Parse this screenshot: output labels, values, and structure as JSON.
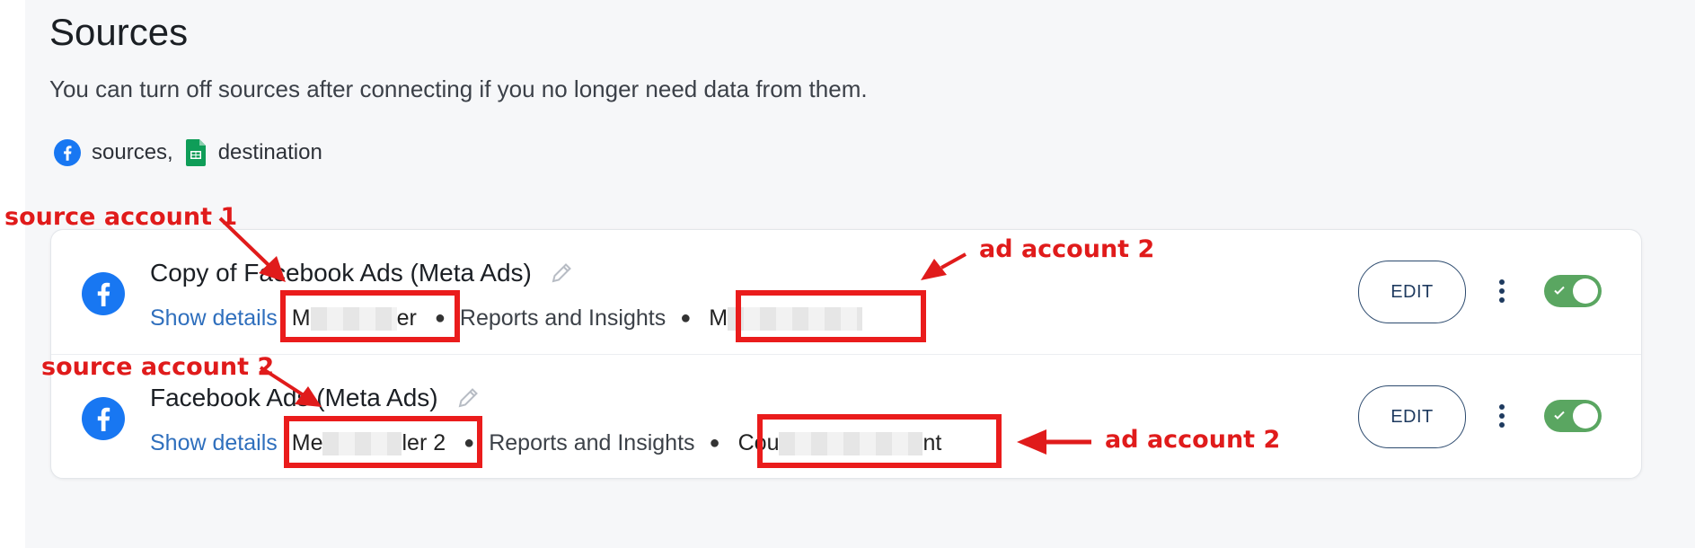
{
  "header": {
    "title": "Sources",
    "subtitle": "You can turn off sources after connecting if you no longer need data from them."
  },
  "legend": {
    "sources_label": "sources,",
    "destination_label": "destination"
  },
  "sources": [
    {
      "name": "Copy of Facebook Ads (Meta Ads)",
      "show_details": "Show details",
      "account_start": "M",
      "account_end": "er",
      "report": "Reports and Insights",
      "ad_account_start": "M",
      "ad_account_end": "",
      "edit": "EDIT",
      "enabled": true
    },
    {
      "name": "Facebook Ads (Meta Ads)",
      "show_details": "Show details",
      "account_start": "Me",
      "account_end": "ler 2",
      "report": "Reports and Insights",
      "ad_account_start": "Cou",
      "ad_account_end": "nt",
      "edit": "EDIT",
      "enabled": true
    }
  ],
  "annotations": {
    "source_account_1": "source account 1",
    "source_account_2": "source account 2",
    "ad_account_top": "ad account 2",
    "ad_account_bottom": "ad account 2"
  },
  "colors": {
    "facebook": "#1877f2",
    "sheets": "#0f9d58",
    "toggle_on": "#5aa661",
    "link": "#2f6fbd",
    "annotation": "#e01b1b"
  },
  "icons": {
    "source": "facebook-icon",
    "destination": "google-sheets-icon",
    "rename": "pencil-icon",
    "menu": "kebab-menu-icon",
    "toggle": "check-icon"
  }
}
